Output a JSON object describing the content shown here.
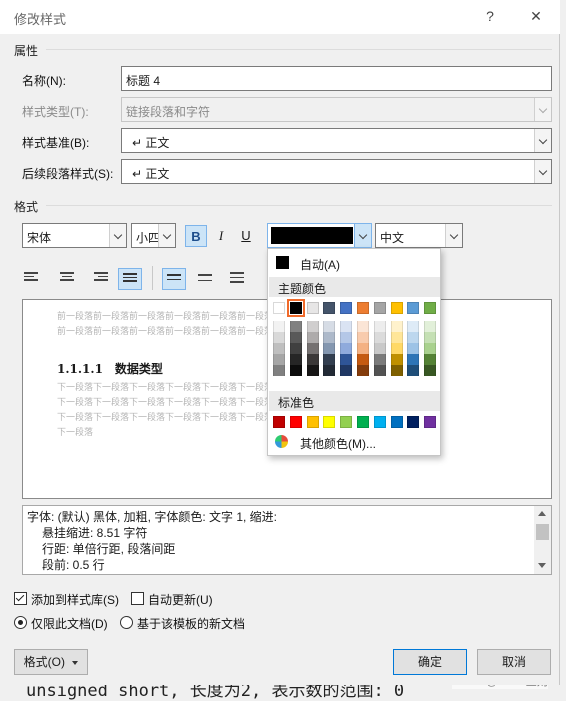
{
  "dialog": {
    "title": "修改样式",
    "help": "?",
    "close": "✕"
  },
  "properties": {
    "section_label": "属性",
    "name_label": "名称(N):",
    "name_value": "标题 4",
    "style_type_label": "样式类型(T):",
    "style_type_value": "链接段落和字符",
    "based_on_label": "样式基准(B):",
    "based_on_value": "↵ 正文",
    "next_style_label": "后续段落样式(S):",
    "next_style_value": "↵ 正文"
  },
  "format": {
    "section_label": "格式",
    "font": "宋体",
    "size": "小四",
    "bold": "B",
    "italic": "I",
    "underline": "U",
    "script": "中文"
  },
  "color_popup": {
    "auto_label": "自动(A)",
    "theme_label": "主题颜色",
    "standard_label": "标准色",
    "more_label": "其他颜色(M)...",
    "theme_top": [
      "#ffffff",
      "#000000",
      "#e7e6e6",
      "#44546a",
      "#4472c4",
      "#ed7d31",
      "#a5a5a5",
      "#ffc000",
      "#5b9bd5",
      "#70ad47"
    ],
    "theme_shades": [
      [
        "#f2f2f2",
        "#d9d9d9",
        "#bfbfbf",
        "#a6a6a6",
        "#808080"
      ],
      [
        "#808080",
        "#595959",
        "#404040",
        "#262626",
        "#0d0d0d"
      ],
      [
        "#d0cece",
        "#aeabab",
        "#757171",
        "#3b3838",
        "#171616"
      ],
      [
        "#d6dce5",
        "#adb9ca",
        "#8497b0",
        "#333f50",
        "#222a35"
      ],
      [
        "#dae3f3",
        "#b4c7e7",
        "#8faadc",
        "#2f5597",
        "#203864"
      ],
      [
        "#fbe5d6",
        "#f8cbad",
        "#f4b183",
        "#c55a11",
        "#843c0c"
      ],
      [
        "#ededed",
        "#dbdbdb",
        "#c9c9c9",
        "#7b7b7b",
        "#525252"
      ],
      [
        "#fff2cc",
        "#ffe699",
        "#ffd966",
        "#bf9000",
        "#7f6000"
      ],
      [
        "#deebf7",
        "#bdd7ee",
        "#9dc3e6",
        "#2e75b6",
        "#1f4e79"
      ],
      [
        "#e2f0d9",
        "#c5e0b4",
        "#a9d18e",
        "#548235",
        "#385723"
      ]
    ],
    "standard": [
      "#c00000",
      "#ff0000",
      "#ffc000",
      "#ffff00",
      "#92d050",
      "#00b050",
      "#00b0f0",
      "#0070c0",
      "#002060",
      "#7030a0"
    ]
  },
  "preview": {
    "before_1": "前一段落前一段落前一段落前一段落前一段落前一段落前一段落前一段落前一段落前一段落",
    "before_2": "前一段落前一段落前一段落前一段落前一段落前一段落前一段落前一段落前一段落前一段落",
    "heading": "1.1.1.1　数据类型",
    "after_1": "下一段落下一段落下一段落下一段落下一段落下一段落下一段落下一段落下一段落下一段落",
    "after_2": "下一段落下一段落下一段落下一段落下一段落下一段落下一段落下一段落下一段落下一段落",
    "after_3": "下一段落下一段落下一段落下一段落下一段落下一段落下一段落下一段落下一段落下一段落",
    "after_4": "下一段落"
  },
  "description": {
    "line1": "字体: (默认) 黑体, 加粗, 字体颜色: 文字 1, 缩进:",
    "line2": "悬挂缩进: 8.51 字符",
    "line3": "行距: 单倍行距, 段落间距",
    "line4": "段前: 0.5 行"
  },
  "options": {
    "add_to_gallery": "添加到样式库(S)",
    "auto_update": "自动更新(U)",
    "only_this_doc": "仅限此文档(D)",
    "new_from_template": "基于该模板的新文档"
  },
  "buttons": {
    "format": "格式(O)",
    "ok": "确定",
    "cancel": "取消"
  },
  "background": {
    "bottom_text": "unsigned short, 长度为2, 表示数的范围: 0",
    "watermark": "CSDN @Turbo正则"
  }
}
